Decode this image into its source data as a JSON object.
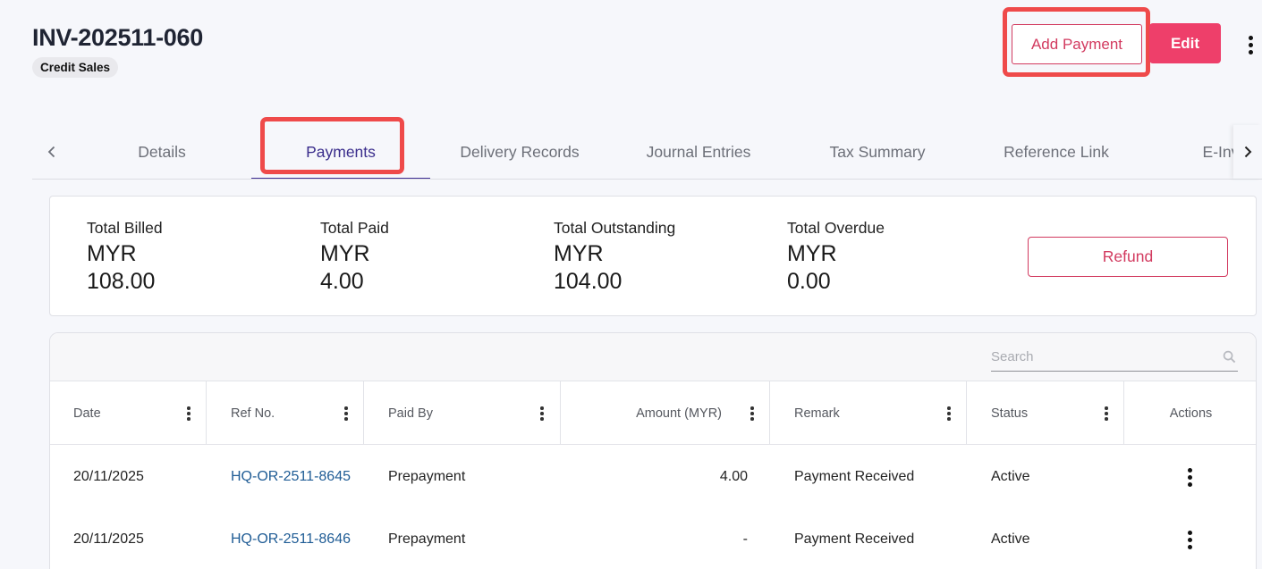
{
  "header": {
    "invoice_number": "INV-202511-060",
    "invoice_type": "Credit Sales",
    "add_payment_label": "Add Payment",
    "edit_label": "Edit"
  },
  "tabs": [
    {
      "label": "Details",
      "active": false
    },
    {
      "label": "Payments",
      "active": true
    },
    {
      "label": "Delivery Records",
      "active": false
    },
    {
      "label": "Journal Entries",
      "active": false
    },
    {
      "label": "Tax Summary",
      "active": false
    },
    {
      "label": "Reference Link",
      "active": false
    },
    {
      "label": "E-Invoice",
      "active": false
    }
  ],
  "summary": {
    "total_billed": {
      "label": "Total Billed",
      "currency": "MYR",
      "amount": "108.00"
    },
    "total_paid": {
      "label": "Total Paid",
      "currency": "MYR",
      "amount": "4.00"
    },
    "total_outstanding": {
      "label": "Total Outstanding",
      "currency": "MYR",
      "amount": "104.00"
    },
    "total_overdue": {
      "label": "Total Overdue",
      "currency": "MYR",
      "amount": "0.00"
    },
    "refund_label": "Refund"
  },
  "table": {
    "search_placeholder": "Search",
    "columns": [
      "Date",
      "Ref No.",
      "Paid By",
      "Amount (MYR)",
      "Remark",
      "Status",
      "Actions"
    ],
    "rows": [
      {
        "date": "20/11/2025",
        "ref_no": "HQ-OR-2511-8645",
        "paid_by": "Prepayment",
        "amount": "4.00",
        "remark": "Payment Received",
        "status": "Active"
      },
      {
        "date": "20/11/2025",
        "ref_no": "HQ-OR-2511-8646",
        "paid_by": "Prepayment",
        "amount": "-",
        "remark": "Payment Received",
        "status": "Active"
      }
    ]
  },
  "colors": {
    "accent": "#ee3f6a",
    "outline_accent": "#d23a5f",
    "active_tab": "#3d2d92",
    "link": "#1f5c95",
    "annotation": "#ef4a4a"
  }
}
